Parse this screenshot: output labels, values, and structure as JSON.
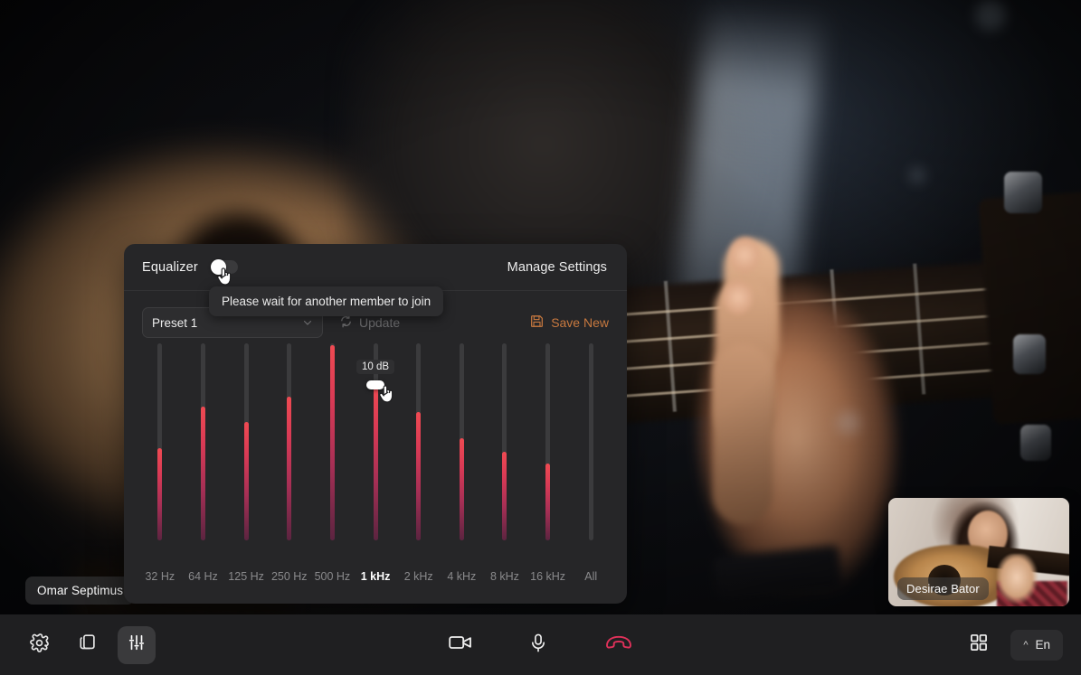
{
  "call": {
    "main_participant_name": "Omar Septimus",
    "self_participant_name": "Desirae Bator"
  },
  "equalizer": {
    "title": "Equalizer",
    "enabled": false,
    "manage_settings_label": "Manage Settings",
    "tooltip": "Please wait for another member to join",
    "preset": {
      "selected": "Preset 1",
      "chevron_icon": "chevron-down-icon"
    },
    "update_label": "Update",
    "update_icon": "refresh-icon",
    "update_disabled": true,
    "save_new_label": "Save New",
    "save_new_icon": "floppy-disk-icon",
    "accent_color": "#c8793f",
    "fill_top_color": "#ef4a52",
    "fill_bottom_color": "#5b2440",
    "active_band_tooltip": "10 dB",
    "bands": [
      {
        "label": "32 Hz",
        "value_pct": 47,
        "active": false
      },
      {
        "label": "64 Hz",
        "value_pct": 68,
        "active": false
      },
      {
        "label": "125 Hz",
        "value_pct": 60,
        "active": false
      },
      {
        "label": "250 Hz",
        "value_pct": 73,
        "active": false
      },
      {
        "label": "500 Hz",
        "value_pct": 99,
        "active": false
      },
      {
        "label": "1 kHz",
        "value_pct": 79,
        "active": true
      },
      {
        "label": "2 kHz",
        "value_pct": 65,
        "active": false
      },
      {
        "label": "4 kHz",
        "value_pct": 52,
        "active": false
      },
      {
        "label": "8 kHz",
        "value_pct": 45,
        "active": false
      },
      {
        "label": "16 kHz",
        "value_pct": 39,
        "active": false
      },
      {
        "label": "All",
        "value_pct": 0,
        "active": false
      }
    ]
  },
  "toolbar": {
    "settings_icon": "gear-icon",
    "layout_icon": "copy-icon",
    "equalizer_icon": "sliders-icon",
    "camera_icon": "video-camera-icon",
    "microphone_icon": "microphone-icon",
    "hangup_icon": "phone-hangup-icon",
    "grid_icon": "grid-view-icon",
    "language_label": "En",
    "language_caret": "^"
  }
}
